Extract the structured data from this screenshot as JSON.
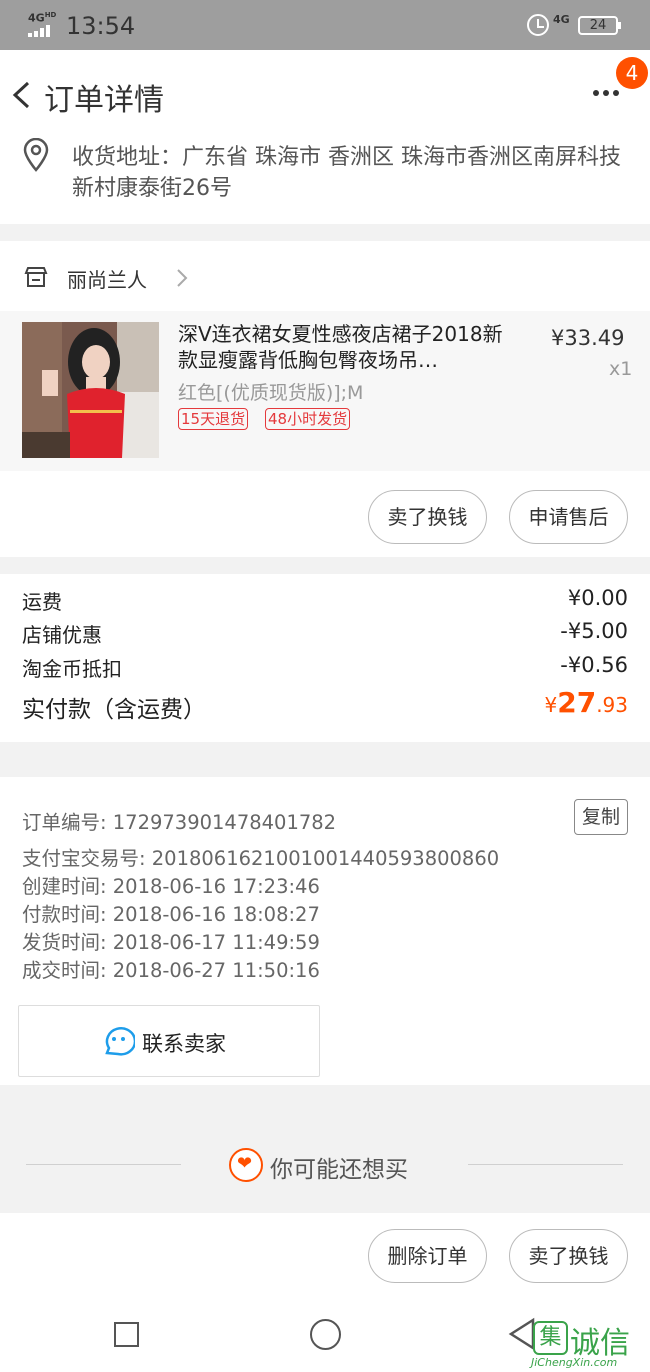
{
  "status_bar": {
    "network": "4G",
    "network_hd": "HD",
    "time": "13:54",
    "network_2": "4G",
    "battery": "24"
  },
  "header": {
    "title": "订单详情",
    "badge_count": "4"
  },
  "address": {
    "text": "收货地址：广东省 珠海市 香洲区 珠海市香洲区南屏科技新村康泰街26号"
  },
  "shop": {
    "name": "丽尚兰人"
  },
  "product": {
    "title": "深V连衣裙女夏性感夜店裙子2018新款显瘦露背低胸包臀夜场吊…",
    "price": "¥33.49",
    "quantity": "x1",
    "sku": "红色[(优质现货版)];M",
    "tags": [
      "15天退货",
      "48小时发货"
    ]
  },
  "product_actions": {
    "sell_label": "卖了换钱",
    "aftersale_label": "申请售后"
  },
  "costs": {
    "rows": [
      {
        "label": "运费",
        "value": "¥0.00"
      },
      {
        "label": "店铺优惠",
        "value": "-¥5.00"
      },
      {
        "label": "淘金币抵扣",
        "value": "-¥0.56"
      }
    ],
    "total_label": "实付款（含运费）",
    "total_symbol": "¥",
    "total_int": "27",
    "total_dec": ".93"
  },
  "order_info": {
    "rows": [
      "订单编号: 172973901478401782",
      "支付宝交易号: 2018061621001001440593800860",
      "创建时间: 2018-06-16 17:23:46",
      "付款时间: 2018-06-16 18:08:27",
      "发货时间: 2018-06-17 11:49:59",
      "成交时间: 2018-06-27 11:50:16"
    ],
    "copy_label": "复制",
    "contact_label": "联系卖家"
  },
  "recommend": {
    "label": "你可能还想买"
  },
  "bottom_actions": {
    "delete_label": "删除订单",
    "sell_label": "卖了换钱"
  },
  "watermark": {
    "char": "集",
    "text": "诚信",
    "url": "JiChengXin.com"
  },
  "colors": {
    "accent": "#ff5000",
    "tag_red": "#e4393c",
    "status_bar": "#9e9e9e",
    "watermark_green": "#3aa34a"
  },
  "icons": [
    "back-arrow-icon",
    "more-icon",
    "location-icon",
    "shop-icon",
    "chevron-right-icon",
    "chat-face-icon",
    "heart-icon",
    "nav-square-icon",
    "nav-circle-icon",
    "nav-back-icon"
  ]
}
